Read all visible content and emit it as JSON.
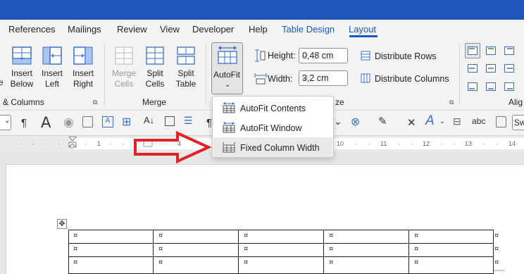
{
  "tabs": [
    {
      "label": "References"
    },
    {
      "label": "Mailings"
    },
    {
      "label": "Review"
    },
    {
      "label": "View"
    },
    {
      "label": "Developer"
    },
    {
      "label": "Help"
    },
    {
      "label": "Table Design"
    },
    {
      "label": "Layout"
    }
  ],
  "ribbon": {
    "insert_below": "Insert\nBelow",
    "insert_left": "Insert\nLeft",
    "insert_right": "Insert\nRight",
    "rows_columns_group": "& Columns",
    "merge_cells": "Merge\nCells",
    "split_cells": "Split\nCells",
    "split_table": "Split\nTable",
    "merge_group": "Merge",
    "autofit": "AutoFit",
    "height_label": "Height:",
    "height_value": "0,48 cm",
    "width_label": "Width:",
    "width_value": "3,2 cm",
    "distribute_rows": "Distribute Rows",
    "distribute_columns": "Distribute Columns",
    "cell_size_group_fragment": "ze",
    "alignment_group_fragment": "Alig",
    "left_fragment": "e",
    "toolbar_fragment": "Sw"
  },
  "menu": {
    "items": [
      {
        "label": "AutoFit Contents"
      },
      {
        "label": "AutoFit Window"
      },
      {
        "label": "Fixed Column Width"
      }
    ]
  },
  "table": {
    "cell_mark": "¤",
    "rows": 3,
    "columns": 5
  },
  "annotation": {
    "arrow_color": "#e32227"
  },
  "colors": {
    "titlebar": "#1d56b8",
    "accent": "#185abd"
  }
}
